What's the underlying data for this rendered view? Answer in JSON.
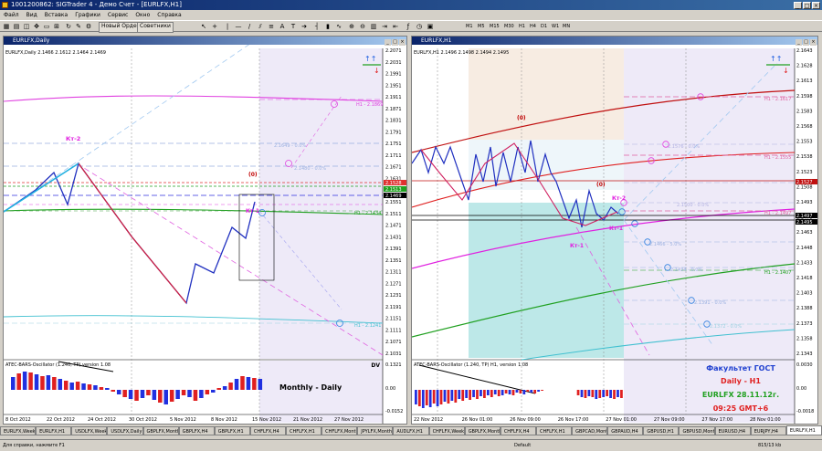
{
  "app": {
    "title": "1001200862: SIGTrader 4 - Демо Счет - [EURLFX,H1]",
    "controls": [
      "_",
      "□",
      "×"
    ]
  },
  "menu": [
    "Файл",
    "Вид",
    "Вставка",
    "Графики",
    "Сервис",
    "Окно",
    "Справка"
  ],
  "toolbar": {
    "new_order": "Новый Ордер",
    "advisors": "Советники",
    "timeframes": [
      "M1",
      "M5",
      "M15",
      "M30",
      "H1",
      "H4",
      "D1",
      "W1",
      "MN"
    ]
  },
  "left_chart": {
    "window_title": "EURLFX,Daily",
    "info_line": "EURLFX,Daily  2.1466 2.1612 2.1464 2.1469",
    "labels": {
      "kt2": "Кт-2",
      "kt1": "Кт-1",
      "zero": "(0)",
      "dv": "DV",
      "note": "Monthly - Daily"
    },
    "levels": {
      "h1": "H1 - 2.1869",
      "l1": "2.1649 - 0.0%",
      "l2": "2.1480 - 0.0%",
      "h2": "H1 - 2.1434",
      "h3": "H1 - 2.1241"
    },
    "price_ticks": [
      "2.2071",
      "2.2031",
      "2.1991",
      "2.1951",
      "2.1911",
      "2.1871",
      "2.1831",
      "2.1791",
      "2.1751",
      "2.1711",
      "2.1671",
      "2.1631",
      "2.1591",
      "2.1551",
      "2.1511",
      "2.1471",
      "2.1431",
      "2.1391",
      "2.1351",
      "2.1311",
      "2.1271",
      "2.1231",
      "2.1191",
      "2.1151",
      "2.1111",
      "2.1071",
      "2.1031"
    ],
    "price_tags": [
      "2.1528",
      "2.1513",
      "2.1469"
    ],
    "osc_title": "ATEC-BARS-Oscillator (1.240, TP) version 1.08",
    "osc_ticks": [
      "0.1321",
      "0.00",
      "-0.0152"
    ],
    "date_ticks": [
      "8 Oct 2012",
      "22 Oct 2012",
      "24 Oct 2012",
      "30 Oct 2012",
      "5 Nov 2012",
      "8 Nov 2012",
      "15 Nov 2012",
      "21 Nov 2012",
      "27 Nov 2012"
    ]
  },
  "right_chart": {
    "window_title": "EURLFX,H1",
    "info_line": "EURLFX,H1  2.1496 2.1498 2.1494 2.1495",
    "labels": {
      "zero": "(0)",
      "kt1": "Кт-1",
      "kt2": "Кт-2",
      "kt1b": "Кт-1"
    },
    "levels": {
      "h1": "H1 - 2.1617",
      "h2": "H1 - 2.1555",
      "h3": "H1 - 2.1497",
      "h4": "H1 - 2.1407",
      "l1": "2.1576 - 0.0%",
      "l2": "2.1500 - 0.0%",
      "l3": "2.1466 - 5.0%",
      "l4": "2.1434 - 0.0%",
      "l5": "2.1391 - 0.0%",
      "l6": "2.1372 - 0.0%"
    },
    "price_ticks": [
      "2.1643",
      "2.1628",
      "2.1613",
      "2.1598",
      "2.1583",
      "2.1568",
      "2.1553",
      "2.1538",
      "2.1523",
      "2.1508",
      "2.1493",
      "2.1478",
      "2.1463",
      "2.1448",
      "2.1433",
      "2.1418",
      "2.1403",
      "2.1388",
      "2.1373",
      "2.1358",
      "2.1343"
    ],
    "price_tags": [
      "2.1527",
      "2.1497",
      "2.1495"
    ],
    "osc_title": "ATEC-BARS-Oscillator (1.240, TP) H1, version 1.08",
    "osc_ticks": [
      "0.0030",
      "0.00",
      "-0.0018"
    ],
    "date_ticks": [
      "22 Nov 2012",
      "26 Nov 01:00",
      "26 Nov 09:00",
      "26 Nov 17:00",
      "27 Nov 01:00",
      "27 Nov 09:00",
      "27 Nov 17:00",
      "28 Nov 01:00"
    ],
    "watermark": {
      "line1": "Факультет ГОСТ",
      "line2": "Daily - H1",
      "line3": "EURLFX 28.11.12г.",
      "line4": "09:25 GMT+6"
    }
  },
  "tabs": [
    "EURLFX,Weekly",
    "EURLFX,H1",
    "USDLFX,Weekly",
    "USDLFX,Daily",
    "GBPLFX,Monthly",
    "GBPLFX,H4",
    "GBPLFX,H1",
    "CHFLFX,H4",
    "CHFLFX,H1",
    "CHFLFX,Monthly",
    "JPYLFX,Monthly",
    "AUDLFX,H1",
    "CHFLFX,Weekly",
    "GBPLFX,Monthly",
    "CHFLFX,H4",
    "CHFLFX,H1",
    "GBPCAD,Monthly",
    "GBPAUD,H4",
    "GBPUSD,H1",
    "GBPUSD,Monthly",
    "EURUSD,H4",
    "EURJPY,H4",
    "EURLFX,H1"
  ],
  "active_tab": "EURLFX,H1",
  "status": {
    "hint": "Для справки, нажмите F1",
    "profile": "Default",
    "traffic": "815/13 kb"
  }
}
